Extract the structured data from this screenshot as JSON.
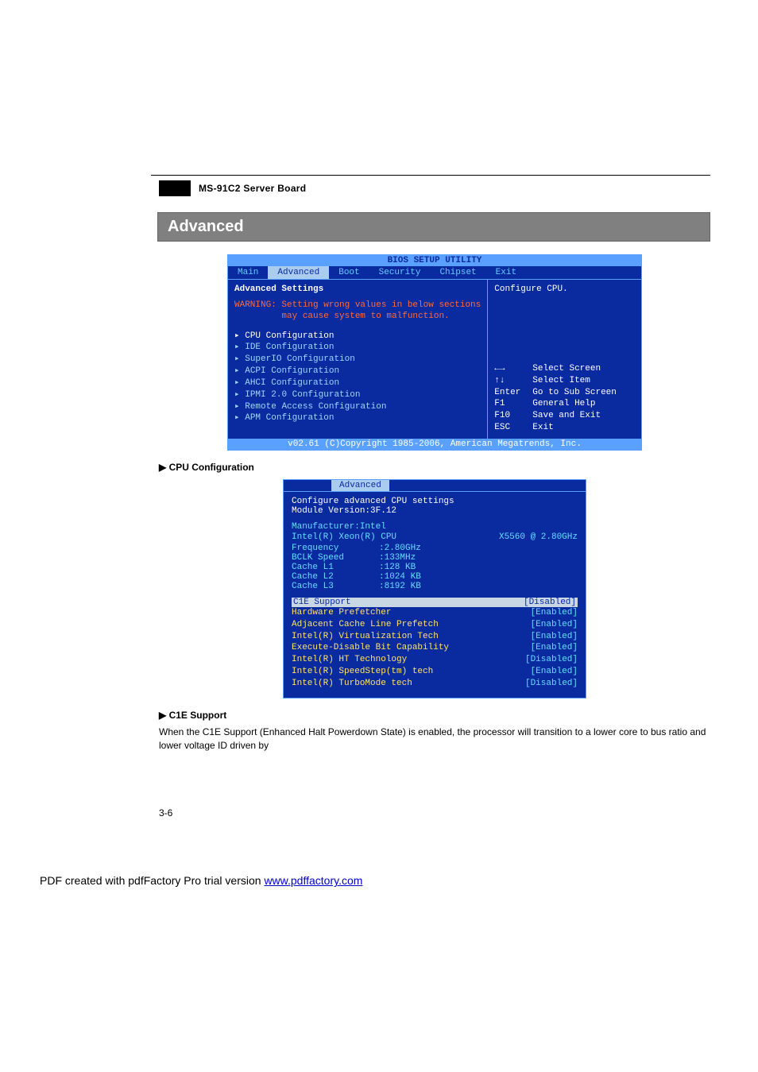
{
  "header": {
    "board_title": "MS-91C2 Server Board"
  },
  "section": {
    "title": "Advanced"
  },
  "bios_main": {
    "title": "BIOS SETUP UTILITY",
    "tabs": [
      "Main",
      "Advanced",
      "Boot",
      "Security",
      "Chipset",
      "Exit"
    ],
    "left_heading": "Advanced Settings",
    "warning": "WARNING: Setting wrong values in below sections\n         may cause system to malfunction.",
    "menu": [
      "CPU Configuration",
      "IDE Configuration",
      "SuperIO Configuration",
      "ACPI Configuration",
      "AHCI Configuration",
      "IPMI 2.0 Configuration",
      "Remote Access Configuration",
      "APM Configuration"
    ],
    "right_help_title": "Configure CPU.",
    "keys": [
      {
        "k": "←→",
        "d": "Select Screen"
      },
      {
        "k": "↑↓",
        "d": "Select Item"
      },
      {
        "k": "Enter",
        "d": "Go to Sub Screen"
      },
      {
        "k": "F1",
        "d": "General Help"
      },
      {
        "k": "F10",
        "d": "Save and Exit"
      },
      {
        "k": "ESC",
        "d": "Exit"
      }
    ],
    "footer": "v02.61 (C)Copyright 1985-2006, American Megatrends, Inc."
  },
  "cpu_section_head": "▶ CPU Configuration",
  "bios_cpu": {
    "tab": "Advanced",
    "title": "Configure advanced CPU settings",
    "module": "Module Version:3F.12",
    "specs": {
      "manufacturer": "Manufacturer:Intel",
      "cpu": "Intel(R) Xeon(R) CPU",
      "cpu_model": "X5560  @ 2.80GHz",
      "freq_lbl": "Frequency",
      "freq_val": ":2.80GHz",
      "bclk_lbl": "BCLK Speed",
      "bclk_val": ":133MHz",
      "l1_lbl": "Cache L1",
      "l1_val": ":128 KB",
      "l2_lbl": "Cache L2",
      "l2_val": ":1024 KB",
      "l3_lbl": "Cache L3",
      "l3_val": ":8192 KB"
    },
    "options": [
      {
        "name": "C1E Support",
        "value": "[Disabled]",
        "selected": true
      },
      {
        "name": "Hardware Prefetcher",
        "value": "[Enabled]"
      },
      {
        "name": "Adjacent Cache Line Prefetch",
        "value": "[Enabled]"
      },
      {
        "name": "Intel(R) Virtualization Tech",
        "value": "[Enabled]"
      },
      {
        "name": "Execute-Disable Bit Capability",
        "value": "[Enabled]"
      },
      {
        "name": "Intel(R) HT Technology",
        "value": "[Disabled]"
      },
      {
        "name": "Intel(R) SpeedStep(tm) tech",
        "value": "[Enabled]"
      },
      {
        "name": "Intel(R) TurboMode tech",
        "value": "[Disabled]"
      }
    ]
  },
  "c1e": {
    "head": "▶ C1E Support",
    "body": "When the C1E Support (Enhanced Halt Powerdown State) is enabled, the processor will transition to a lower core to bus ratio and lower voltage ID driven  by"
  },
  "page_number": "3-6",
  "pdf_footer": {
    "prefix": "PDF created with pdfFactory Pro trial version ",
    "link": "www.pdffactory.com"
  }
}
